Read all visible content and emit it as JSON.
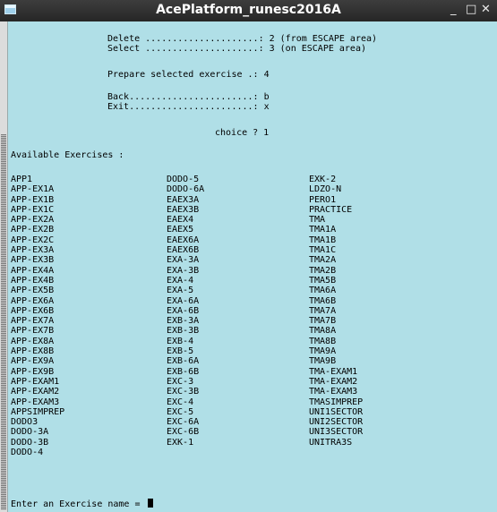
{
  "window": {
    "title": "AcePlatform_runesc2016A",
    "minimize": "_",
    "maximize": "□",
    "close": "✕"
  },
  "menu": {
    "delete": "Delete .....................: 2 (from ESCAPE area)",
    "select": "Select .....................: 3 (on ESCAPE area)",
    "prepare": "Prepare selected exercise .: 4",
    "back": "Back.......................: b",
    "exit": "Exit.......................: x",
    "choice": "choice ? 1"
  },
  "available_label": "Available Exercises :",
  "columns": [
    [
      "APP1",
      "APP-EX1A",
      "APP-EX1B",
      "APP-EX1C",
      "APP-EX2A",
      "APP-EX2B",
      "APP-EX2C",
      "APP-EX3A",
      "APP-EX3B",
      "APP-EX4A",
      "APP-EX4B",
      "APP-EX5B",
      "APP-EX6A",
      "APP-EX6B",
      "APP-EX7A",
      "APP-EX7B",
      "APP-EX8A",
      "APP-EX8B",
      "APP-EX9A",
      "APP-EX9B",
      "APP-EXAM1",
      "APP-EXAM2",
      "APP-EXAM3",
      "APPSIMPREP",
      "DODO3",
      "DODO-3A",
      "DODO-3B",
      "DODO-4"
    ],
    [
      "DODO-5",
      "DODO-6A",
      "EAEX3A",
      "EAEX3B",
      "EAEX4",
      "EAEX5",
      "EAEX6A",
      "EAEX6B",
      "EXA-3A",
      "EXA-3B",
      "EXA-4",
      "EXA-5",
      "EXA-6A",
      "EXA-6B",
      "EXB-3A",
      "EXB-3B",
      "EXB-4",
      "EXB-5",
      "EXB-6A",
      "EXB-6B",
      "EXC-3",
      "EXC-3B",
      "EXC-4",
      "EXC-5",
      "EXC-6A",
      "EXC-6B",
      "EXK-1"
    ],
    [
      "EXK-2",
      "LDZO-N",
      "PERO1",
      "PRACTICE",
      "TMA",
      "TMA1A",
      "TMA1B",
      "TMA1C",
      "TMA2A",
      "TMA2B",
      "TMA5B",
      "TMA6A",
      "TMA6B",
      "TMA7A",
      "TMA7B",
      "TMA8A",
      "TMA8B",
      "TMA9A",
      "TMA9B",
      "TMA-EXAM1",
      "TMA-EXAM2",
      "TMA-EXAM3",
      "TMASIMPREP",
      "UNI1SECTOR",
      "UNI2SECTOR",
      "UNI3SECTOR",
      "UNITRA3S"
    ]
  ],
  "prompt": "Enter an Exercise name = "
}
